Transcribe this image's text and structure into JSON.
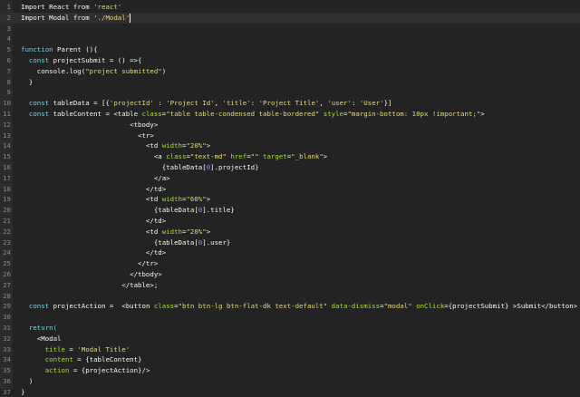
{
  "editor": {
    "lines": [
      {
        "n": "1",
        "segs": [
          {
            "t": "Import React from ",
            "c": ""
          },
          {
            "t": "'react'",
            "c": "str"
          }
        ]
      },
      {
        "n": "2",
        "segs": [
          {
            "t": "Import Modal from ",
            "c": ""
          },
          {
            "t": "'./Modal'",
            "c": "str"
          },
          {
            "t": "",
            "c": "cursor"
          }
        ]
      },
      {
        "n": "3",
        "segs": []
      },
      {
        "n": "4",
        "segs": []
      },
      {
        "n": "5",
        "segs": [
          {
            "t": "function ",
            "c": "kw"
          },
          {
            "t": "Parent (){",
            "c": ""
          }
        ]
      },
      {
        "n": "6",
        "segs": [
          {
            "t": "  const ",
            "c": "kw"
          },
          {
            "t": "projectSubmit = () =>{",
            "c": ""
          }
        ]
      },
      {
        "n": "7",
        "segs": [
          {
            "t": "    console.log(",
            "c": ""
          },
          {
            "t": "\"project submitted\"",
            "c": "str"
          },
          {
            "t": ")",
            "c": ""
          }
        ]
      },
      {
        "n": "8",
        "segs": [
          {
            "t": "  }",
            "c": ""
          }
        ]
      },
      {
        "n": "9",
        "segs": []
      },
      {
        "n": "10",
        "segs": [
          {
            "t": "  const ",
            "c": "kw"
          },
          {
            "t": "tableData = [{",
            "c": ""
          },
          {
            "t": "'projectId'",
            "c": "str"
          },
          {
            "t": " : ",
            "c": ""
          },
          {
            "t": "'Project Id'",
            "c": "str"
          },
          {
            "t": ", ",
            "c": ""
          },
          {
            "t": "'title'",
            "c": "str"
          },
          {
            "t": ": ",
            "c": ""
          },
          {
            "t": "'Project Title'",
            "c": "str"
          },
          {
            "t": ", ",
            "c": ""
          },
          {
            "t": "'user'",
            "c": "str"
          },
          {
            "t": ": ",
            "c": ""
          },
          {
            "t": "'User'",
            "c": "str"
          },
          {
            "t": "}]",
            "c": ""
          }
        ]
      },
      {
        "n": "11",
        "segs": [
          {
            "t": "  const ",
            "c": "kw"
          },
          {
            "t": "tableContent = <table ",
            "c": ""
          },
          {
            "t": "class",
            "c": "attr"
          },
          {
            "t": "=",
            "c": ""
          },
          {
            "t": "\"table table-condensed table-bordered\"",
            "c": "str"
          },
          {
            "t": " ",
            "c": ""
          },
          {
            "t": "style",
            "c": "attr"
          },
          {
            "t": "=",
            "c": ""
          },
          {
            "t": "\"margin-bottom: 10px !important;\"",
            "c": "str"
          },
          {
            "t": ">",
            "c": ""
          }
        ]
      },
      {
        "n": "12",
        "segs": [
          {
            "t": "                           <tbody>",
            "c": ""
          }
        ]
      },
      {
        "n": "13",
        "segs": [
          {
            "t": "                             <tr>",
            "c": ""
          }
        ]
      },
      {
        "n": "14",
        "segs": [
          {
            "t": "                               <td ",
            "c": ""
          },
          {
            "t": "width",
            "c": "attr"
          },
          {
            "t": "=",
            "c": ""
          },
          {
            "t": "\"20%\"",
            "c": "str"
          },
          {
            "t": ">",
            "c": ""
          }
        ]
      },
      {
        "n": "15",
        "segs": [
          {
            "t": "                                 <a ",
            "c": ""
          },
          {
            "t": "class",
            "c": "attr"
          },
          {
            "t": "=",
            "c": ""
          },
          {
            "t": "\"text-md\"",
            "c": "str"
          },
          {
            "t": " ",
            "c": ""
          },
          {
            "t": "href",
            "c": "attr"
          },
          {
            "t": "=",
            "c": ""
          },
          {
            "t": "\"\"",
            "c": "str"
          },
          {
            "t": " ",
            "c": ""
          },
          {
            "t": "target",
            "c": "attr"
          },
          {
            "t": "=",
            "c": ""
          },
          {
            "t": "\"_blank\"",
            "c": "str"
          },
          {
            "t": ">",
            "c": ""
          }
        ]
      },
      {
        "n": "16",
        "segs": [
          {
            "t": "                                   {tableData[",
            "c": ""
          },
          {
            "t": "0",
            "c": "num"
          },
          {
            "t": "].projectId}",
            "c": ""
          }
        ]
      },
      {
        "n": "17",
        "segs": [
          {
            "t": "                                 </a>",
            "c": ""
          }
        ]
      },
      {
        "n": "18",
        "segs": [
          {
            "t": "                               </td>",
            "c": ""
          }
        ]
      },
      {
        "n": "19",
        "segs": [
          {
            "t": "                               <td ",
            "c": ""
          },
          {
            "t": "width",
            "c": "attr"
          },
          {
            "t": "=",
            "c": ""
          },
          {
            "t": "\"60%\"",
            "c": "str"
          },
          {
            "t": ">",
            "c": ""
          }
        ]
      },
      {
        "n": "20",
        "segs": [
          {
            "t": "                                 {tableData[",
            "c": ""
          },
          {
            "t": "0",
            "c": "num"
          },
          {
            "t": "].title}",
            "c": ""
          }
        ]
      },
      {
        "n": "21",
        "segs": [
          {
            "t": "                               </td>",
            "c": ""
          }
        ]
      },
      {
        "n": "22",
        "segs": [
          {
            "t": "                               <td ",
            "c": ""
          },
          {
            "t": "width",
            "c": "attr"
          },
          {
            "t": "=",
            "c": ""
          },
          {
            "t": "\"20%\"",
            "c": "str"
          },
          {
            "t": ">",
            "c": ""
          }
        ]
      },
      {
        "n": "23",
        "segs": [
          {
            "t": "                                 {tableData[",
            "c": ""
          },
          {
            "t": "0",
            "c": "num"
          },
          {
            "t": "].user}",
            "c": ""
          }
        ]
      },
      {
        "n": "24",
        "segs": [
          {
            "t": "                               </td>",
            "c": ""
          }
        ]
      },
      {
        "n": "25",
        "segs": [
          {
            "t": "                             </tr>",
            "c": ""
          }
        ]
      },
      {
        "n": "26",
        "segs": [
          {
            "t": "                           </tbody>",
            "c": ""
          }
        ]
      },
      {
        "n": "27",
        "segs": [
          {
            "t": "                         </table>;",
            "c": ""
          }
        ]
      },
      {
        "n": "28",
        "segs": []
      },
      {
        "n": "29",
        "segs": [
          {
            "t": "  const ",
            "c": "kw"
          },
          {
            "t": "projectAction =  <button ",
            "c": ""
          },
          {
            "t": "class",
            "c": "attr"
          },
          {
            "t": "=",
            "c": ""
          },
          {
            "t": "\"btn btn-lg btn-flat-dk text-default\"",
            "c": "str"
          },
          {
            "t": " ",
            "c": ""
          },
          {
            "t": "data-dismiss",
            "c": "attr"
          },
          {
            "t": "=",
            "c": ""
          },
          {
            "t": "\"modal\"",
            "c": "str"
          },
          {
            "t": " ",
            "c": ""
          },
          {
            "t": "onClick",
            "c": "attr"
          },
          {
            "t": "={projectSubmit} >Submit</button>",
            "c": ""
          }
        ]
      },
      {
        "n": "30",
        "segs": []
      },
      {
        "n": "31",
        "segs": [
          {
            "t": "  return(",
            "c": "kw"
          }
        ]
      },
      {
        "n": "32",
        "segs": [
          {
            "t": "    <Modal",
            "c": ""
          }
        ]
      },
      {
        "n": "33",
        "segs": [
          {
            "t": "      ",
            "c": ""
          },
          {
            "t": "title",
            "c": "attr"
          },
          {
            "t": " = ",
            "c": ""
          },
          {
            "t": "'Modal Title'",
            "c": "str"
          }
        ]
      },
      {
        "n": "34",
        "segs": [
          {
            "t": "      ",
            "c": ""
          },
          {
            "t": "content",
            "c": "attr"
          },
          {
            "t": " = {tableContent}",
            "c": ""
          }
        ]
      },
      {
        "n": "35",
        "segs": [
          {
            "t": "      ",
            "c": ""
          },
          {
            "t": "action",
            "c": "attr"
          },
          {
            "t": " = {projectAction}/>",
            "c": ""
          }
        ]
      },
      {
        "n": "36",
        "segs": [
          {
            "t": "  )",
            "c": ""
          }
        ]
      },
      {
        "n": "37",
        "segs": [
          {
            "t": "}",
            "c": ""
          }
        ]
      }
    ]
  }
}
